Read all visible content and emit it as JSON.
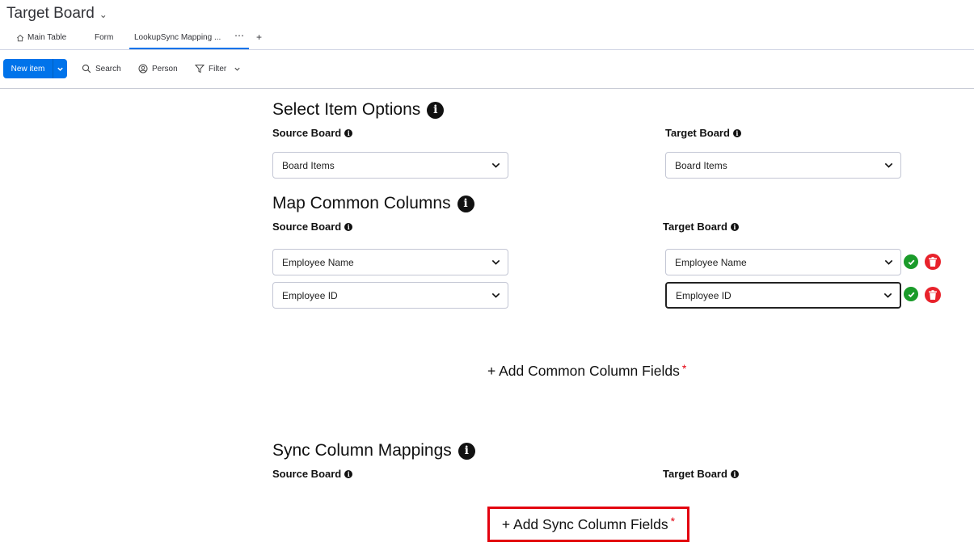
{
  "header": {
    "board_title": "Target Board"
  },
  "tabs": [
    {
      "label": "Main Table",
      "icon": "home-icon"
    },
    {
      "label": "Form"
    },
    {
      "label": "LookupSync Mapping ...",
      "active": true
    },
    {
      "label": "⋯"
    },
    {
      "label": "+"
    }
  ],
  "toolbar": {
    "new_item": "New item",
    "search": "Search",
    "person": "Person",
    "filter": "Filter"
  },
  "select_item_options": {
    "title": "Select Item Options",
    "source_label": "Source Board",
    "target_label": "Target Board",
    "source_value": "Board Items",
    "target_value": "Board Items"
  },
  "map_common_columns": {
    "title": "Map Common Columns",
    "source_label": "Source Board",
    "target_label": "Target Board",
    "rows": [
      {
        "source": "Employee Name",
        "target": "Employee Name"
      },
      {
        "source": "Employee ID",
        "target": "Employee ID"
      }
    ],
    "add_label": "+ Add Common Column Fields",
    "required_mark": "*"
  },
  "sync_column_mappings": {
    "title": "Sync Column Mappings",
    "source_label": "Source Board",
    "target_label": "Target Board",
    "add_label": "+ Add Sync Column Fields",
    "required_mark": "*"
  },
  "colors": {
    "accent": "#0073ea",
    "confirm": "#1a9b2a",
    "delete": "#e8222b",
    "highlight_border": "#e3000f"
  }
}
